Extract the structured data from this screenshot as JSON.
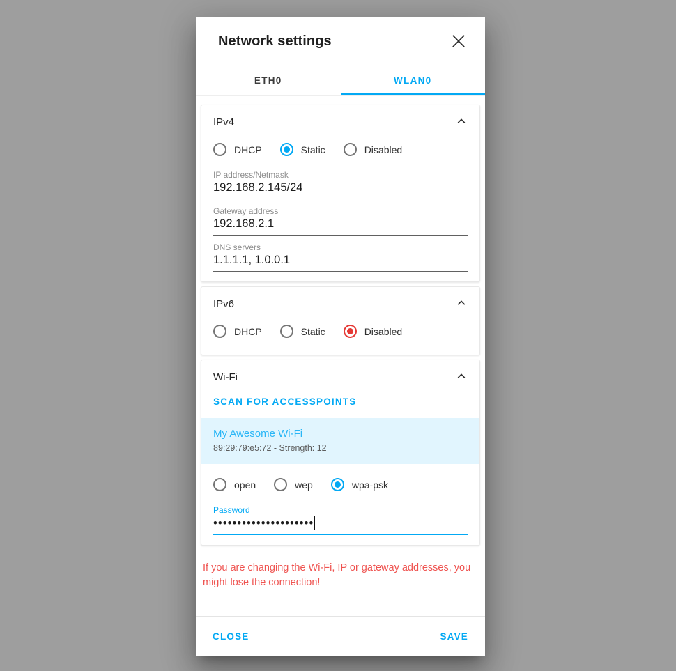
{
  "dialog": {
    "title": "Network settings",
    "close_icon": "close-icon"
  },
  "tabs": [
    {
      "label": "ETH0",
      "active": false
    },
    {
      "label": "WLAN0",
      "active": true
    }
  ],
  "sections": {
    "ipv4": {
      "title": "IPv4",
      "chevron_icon": "chevron-up-icon",
      "modes": [
        {
          "label": "DHCP",
          "selected": false
        },
        {
          "label": "Static",
          "selected": true
        },
        {
          "label": "Disabled",
          "selected": false
        }
      ],
      "fields": [
        {
          "label": "IP address/Netmask",
          "value": "192.168.2.145/24"
        },
        {
          "label": "Gateway address",
          "value": "192.168.2.1"
        },
        {
          "label": "DNS servers",
          "value": "1.1.1.1, 1.0.0.1"
        }
      ]
    },
    "ipv6": {
      "title": "IPv6",
      "chevron_icon": "chevron-up-icon",
      "modes": [
        {
          "label": "DHCP",
          "selected": false
        },
        {
          "label": "Static",
          "selected": false
        },
        {
          "label": "Disabled",
          "selected": true
        }
      ]
    },
    "wifi": {
      "title": "Wi-Fi",
      "chevron_icon": "chevron-up-icon",
      "scan_label": "SCAN FOR ACCESSPOINTS",
      "accesspoints": [
        {
          "ssid": "My Awesome Wi-Fi",
          "meta": "89:29:79:e5:72 - Strength: 12",
          "selected": true
        }
      ],
      "security_modes": [
        {
          "label": "open",
          "selected": false
        },
        {
          "label": "wep",
          "selected": false
        },
        {
          "label": "wpa-psk",
          "selected": true
        }
      ],
      "password_field": {
        "label": "Password",
        "value": "•••••••••••••••••••••",
        "focused": true
      }
    }
  },
  "warning": "If you are changing the Wi-Fi, IP or gateway addresses, you might lose the connection!",
  "footer": {
    "close_label": "CLOSE",
    "save_label": "SAVE"
  },
  "colors": {
    "accent": "#03a9f4",
    "warn": "#e53935",
    "warn_text": "#ef5350",
    "ap_selected_bg": "#e1f5fe"
  }
}
